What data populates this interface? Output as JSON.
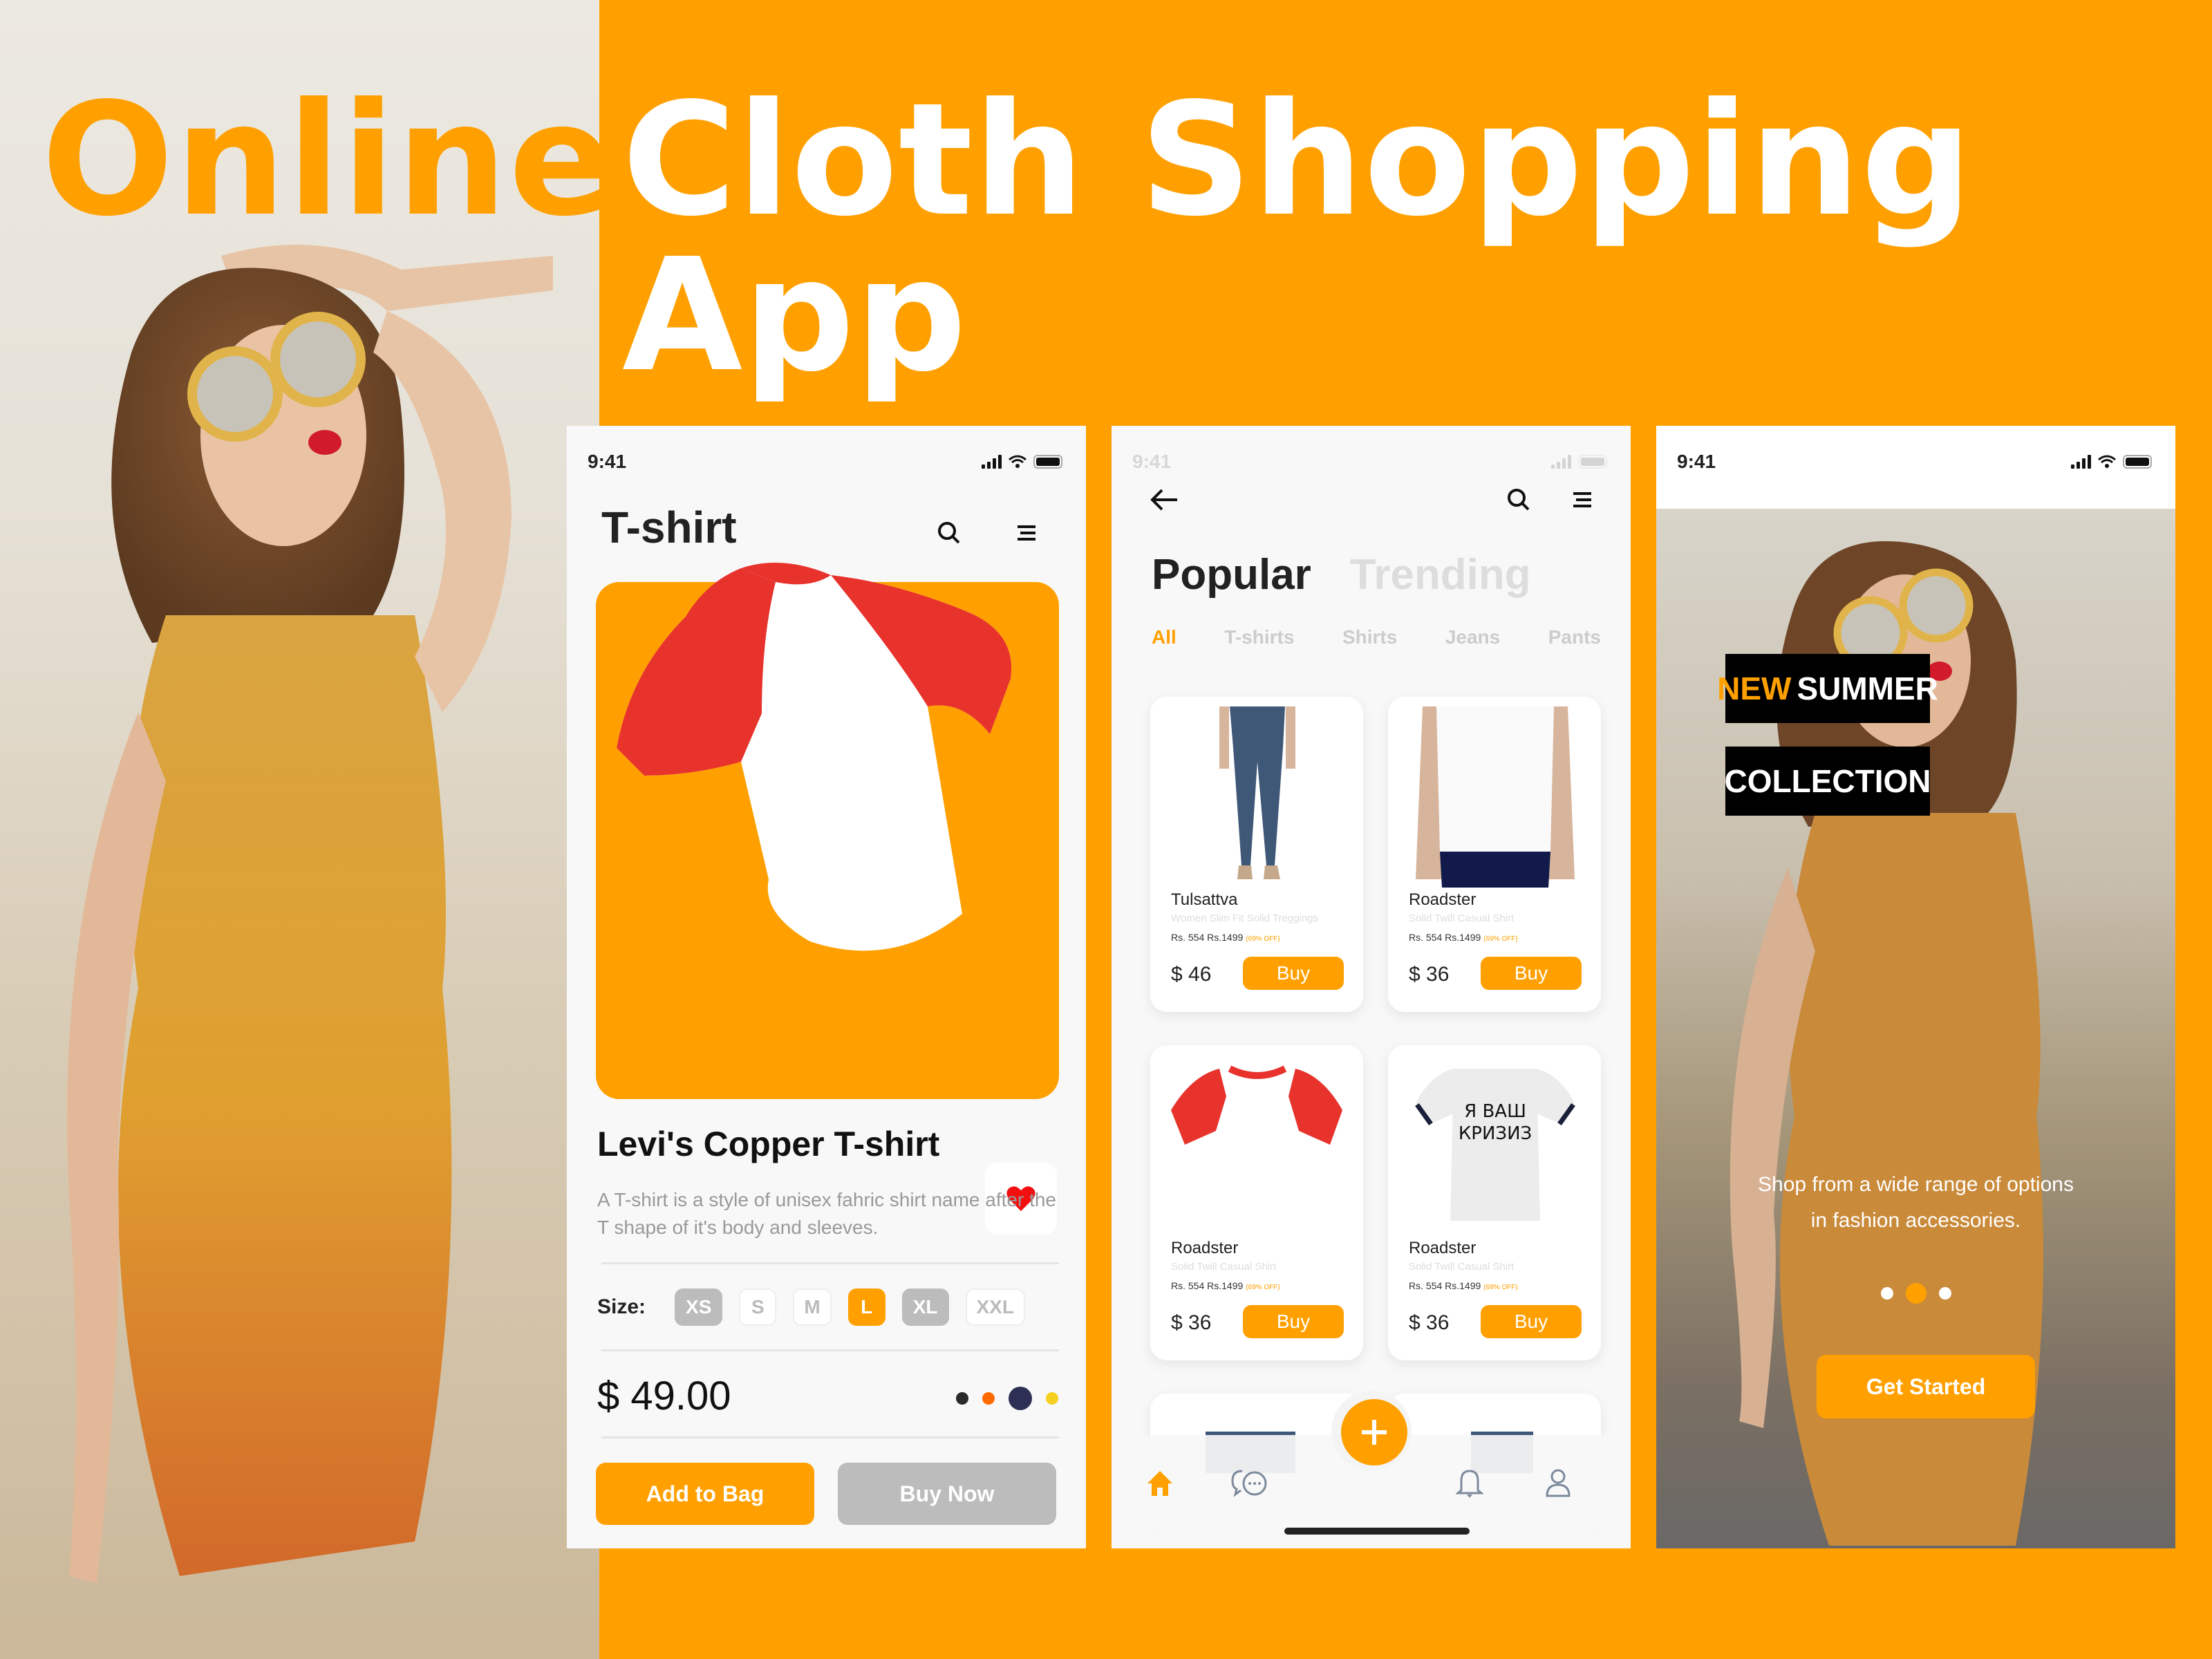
{
  "banner": {
    "word_online": "Online",
    "title": "Cloth Shopping App",
    "accent_color": "#ffa000"
  },
  "status_bar": {
    "time": "9:41"
  },
  "product_screen": {
    "header_title": "T-shirt",
    "icons": [
      "search-icon",
      "menu-icon",
      "heart-icon"
    ],
    "product_name": "Levi's Copper T-shirt",
    "description": "A T-shirt is a style of unisex fahric shirt name after the T shape of it's body and sleeves.",
    "size_label": "Size:",
    "sizes": [
      {
        "label": "XS",
        "state": "disabled"
      },
      {
        "label": "S",
        "state": "available"
      },
      {
        "label": "M",
        "state": "available"
      },
      {
        "label": "L",
        "state": "selected"
      },
      {
        "label": "XL",
        "state": "disabled"
      },
      {
        "label": "XXL",
        "state": "available"
      }
    ],
    "price": "$ 49.00",
    "colors": [
      {
        "hex": "#2a2a2a",
        "selected": false
      },
      {
        "hex": "#ff6a00",
        "selected": false
      },
      {
        "hex": "#2d2f55",
        "selected": true
      },
      {
        "hex": "#f5d020",
        "selected": false
      }
    ],
    "add_to_bag_label": "Add to Bag",
    "buy_now_label": "Buy Now"
  },
  "listing_screen": {
    "tabs": [
      {
        "label": "Popular",
        "active": true
      },
      {
        "label": "Trending",
        "active": false
      }
    ],
    "categories": [
      {
        "label": "All",
        "active": true
      },
      {
        "label": "T-shirts",
        "active": false
      },
      {
        "label": "Shirts",
        "active": false
      },
      {
        "label": "Jeans",
        "active": false
      },
      {
        "label": "Pants",
        "active": false
      }
    ],
    "products": [
      {
        "brand": "Tulsattva",
        "subtitle": "Women Slim Fit Solid Treggings",
        "price_line": "Rs. 554 Rs.1499",
        "discount": "(69% OFF)",
        "price": "$ 46",
        "buy_label": "Buy",
        "image": "jeans"
      },
      {
        "brand": "Roadster",
        "subtitle": "Solid Twill Casual Shirt",
        "price_line": "Rs. 554 Rs.1499",
        "discount": "(69% OFF)",
        "price": "$ 36",
        "buy_label": "Buy",
        "image": "white-tee"
      },
      {
        "brand": "Roadster",
        "subtitle": "Solid Twill Casual Shirt",
        "price_line": "Rs. 554 Rs.1499",
        "discount": "(69% OFF)",
        "price": "$ 36",
        "buy_label": "Buy",
        "image": "raglan-tee"
      },
      {
        "brand": "Roadster",
        "subtitle": "Solid Twill Casual Shirt",
        "price_line": "Rs. 554 Rs.1499",
        "discount": "(69% OFF)",
        "price": "$ 36",
        "buy_label": "Buy",
        "image": "print-tee",
        "print_text_1": "Я ВАШ",
        "print_text_2": "КРИЗИЗ"
      }
    ],
    "nav": [
      "home-icon",
      "chat-icon",
      "add-icon",
      "bell-icon",
      "user-icon"
    ],
    "active_nav": "home-icon"
  },
  "onboarding_screen": {
    "headline_accent": "NEW",
    "headline_rest": "SUMMER",
    "headline_line2": "COLLECTION",
    "subtitle_line1": "Shop from a wide range of options",
    "subtitle_line2": "in fashion accessories.",
    "pager": {
      "count": 3,
      "active_index": 1
    },
    "cta_label": "Get Started"
  }
}
